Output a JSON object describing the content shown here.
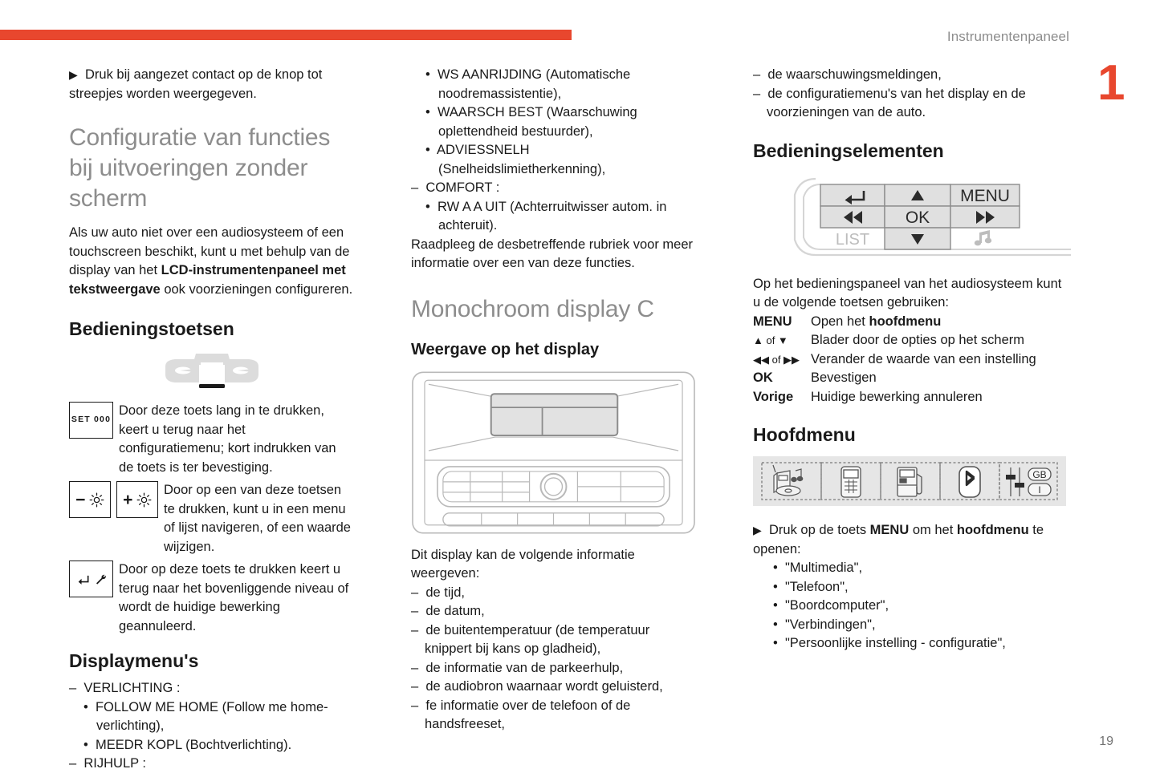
{
  "header": {
    "title": "Instrumentenpaneel",
    "chapter_number": "1",
    "page_number": "19",
    "accent_color": "#e8472e",
    "title_color": "#8d8d8d"
  },
  "col1": {
    "intro_arrow": "▶",
    "intro_text": "Druk bij aangezet contact op de knop tot streepjes worden weergegeven.",
    "section_title": "Configuratie van functies bij uitvoeringen zonder scherm",
    "paragraph_part1": "Als uw auto niet over een audiosysteem of een touchscreen beschikt, kunt u met behulp van de display van het ",
    "paragraph_bold": "LCD-instrumentenpaneel met tekstweergave",
    "paragraph_part2": " ook voorzieningen configureren.",
    "keys_heading": "Bedieningstoetsen",
    "keys": [
      {
        "icon_label": "SET 000",
        "description": "Door deze toets lang in te drukken, keert u terug naar het configuratiemenu; kort indrukken van de toets is ter bevestiging."
      },
      {
        "icon_label": "− / +",
        "description": "Door op een van deze toetsen te drukken, kunt u in een menu of lijst navigeren, of een waarde wijzigen."
      },
      {
        "icon_label": "terug / sleutel",
        "description": "Door op deze toets te drukken keert u terug naar het bovenliggende niveau of wordt de huidige bewerking geannuleerd."
      }
    ],
    "display_menus_heading": "Displaymenu's",
    "display_menus": [
      {
        "dash": "–",
        "label": "VERLICHTING :"
      },
      {
        "bullet": "•",
        "label": "FOLLOW ME HOME (Follow me home-verlichting),"
      },
      {
        "bullet": "•",
        "label": "MEEDR KOPL (Bochtverlichting)."
      },
      {
        "dash": "–",
        "label": "RIJHULP :"
      }
    ]
  },
  "col2": {
    "continued_list": [
      {
        "bullet": "•",
        "label": "WS AANRIJDING (Automatische noodremassistentie),"
      },
      {
        "bullet": "•",
        "label": "WAARSCH BEST (Waarschuwing oplettendheid bestuurder),"
      },
      {
        "bullet": "•",
        "label": "ADVIESSNELH (Snelheidslimietherkenning),"
      },
      {
        "dash": "–",
        "label": "COMFORT :"
      },
      {
        "bullet": "•",
        "label": "RW A A UIT (Achterruitwisser autom. in achteruit)."
      }
    ],
    "consult_text": "Raadpleeg de desbetreffende rubriek voor meer informatie over een van deze functies.",
    "section_title": "Monochroom display C",
    "sub_heading": "Weergave op het display",
    "intro": "Dit display kan de volgende informatie weergeven:",
    "info_items": [
      "de tijd,",
      "de datum,",
      "de buitentemperatuur (de temperatuur knippert bij kans op gladheid),",
      "de informatie van de parkeerhulp,",
      "de audiobron waarnaar wordt geluisterd,",
      "fe informatie over de telefoon of de handsfreeset,"
    ]
  },
  "col3": {
    "info_items_continued": [
      "de waarschuwingsmeldingen,",
      "de configuratiemenu's van het display en de voorzieningen van de auto."
    ],
    "controls_heading": "Bedieningselementen",
    "control_panel": {
      "buttons": [
        {
          "name": "back",
          "label": "↩"
        },
        {
          "name": "up",
          "label": "▲"
        },
        {
          "name": "menu",
          "label": "MENU"
        },
        {
          "name": "rewind",
          "label": "◀◀"
        },
        {
          "name": "ok",
          "label": "OK"
        },
        {
          "name": "forward",
          "label": "▶▶"
        },
        {
          "name": "list",
          "label": "LIST"
        },
        {
          "name": "down",
          "label": "▼"
        },
        {
          "name": "music",
          "label": "♫"
        }
      ]
    },
    "controls_intro": "Op het bedieningspaneel van het audiosysteem kunt u de volgende toetsen gebruiken:",
    "control_rows": [
      {
        "key": "MENU",
        "desc_pre": "Open het ",
        "desc_bold": "hoofdmenu",
        "desc_post": ""
      },
      {
        "key": "▲ of ▼",
        "desc_pre": "Blader door de opties op het scherm",
        "desc_bold": "",
        "desc_post": ""
      },
      {
        "key": "◀◀ of ▶▶",
        "desc_pre": "Verander de waarde van een instelling",
        "desc_bold": "",
        "desc_post": ""
      },
      {
        "key": "OK",
        "desc_pre": "Bevestigen",
        "desc_bold": "",
        "desc_post": ""
      },
      {
        "key": "Vorige",
        "desc_pre": "Huidige bewerking annuleren",
        "desc_bold": "",
        "desc_post": ""
      }
    ],
    "main_menu_heading": "Hoofdmenu",
    "menu_icons": [
      "multimedia-icon",
      "phone-icon",
      "trip-computer-icon",
      "bluetooth-icon",
      "settings-icon"
    ],
    "open_menu_arrow": "▶",
    "open_menu_pre": "Druk op de toets ",
    "open_menu_bold1": "MENU",
    "open_menu_mid": " om het ",
    "open_menu_bold2": "hoofdmenu",
    "open_menu_post": " te openen:",
    "menu_items": [
      "\"Multimedia\",",
      "\"Telefoon\",",
      "\"Boordcomputer\",",
      "\"Verbindingen\",",
      "\"Persoonlijke instelling - configuratie\","
    ]
  }
}
